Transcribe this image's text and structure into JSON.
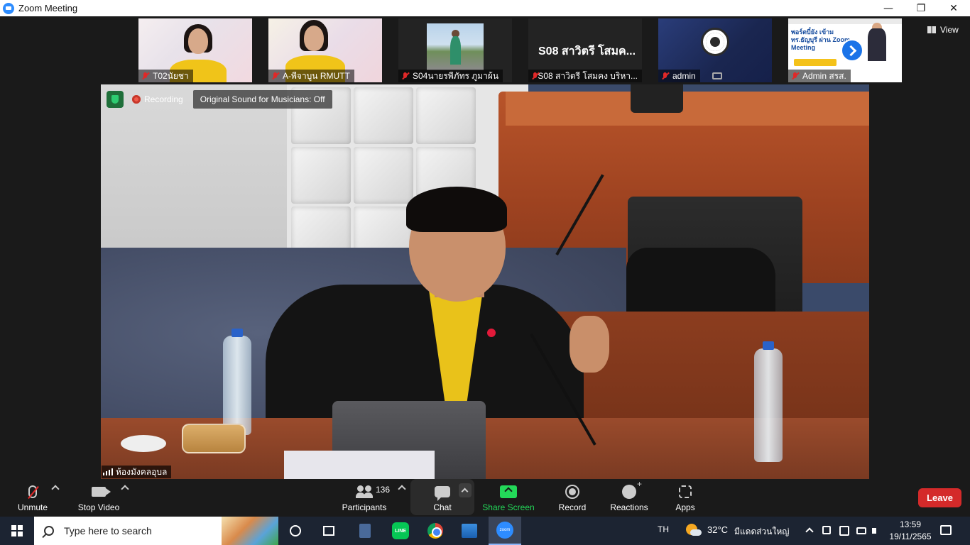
{
  "window": {
    "title": "Zoom Meeting",
    "minimize": "—",
    "restore": "❐",
    "close": "✕"
  },
  "gallery": {
    "view_label": "View",
    "participants": [
      {
        "name": "T02นัยชา",
        "muted": true
      },
      {
        "name": "A-พีจาบูน RMUTT",
        "muted": true
      },
      {
        "name": "S04นายรพีภัทร ภูมาผ้น",
        "muted": true
      },
      {
        "name": "S08 สาวิตรี โสมคง บริหา...",
        "muted": true,
        "display_text": "S08 สาวิตรี โสมค..."
      },
      {
        "name": "admin",
        "muted": true
      },
      {
        "name": "Admin สรส.",
        "muted": true
      }
    ],
    "poster_text": "พอร์ตบี๋ยัง เข้ามทร.ธัญบุรี ผ่าน Zoom Meeting",
    "poster_date": "19 พฤศจิกายน 2565"
  },
  "speaker": {
    "recording_label": "Recording",
    "original_sound_label": "Original Sound for Musicians: Off",
    "room_name": "ห้องมังคลอุบล"
  },
  "toolbar": {
    "unmute": "Unmute",
    "stop_video": "Stop Video",
    "participants": "Participants",
    "participants_count": "136",
    "chat": "Chat",
    "share_screen": "Share Screen",
    "record": "Record",
    "reactions": "Reactions",
    "apps": "Apps",
    "leave": "Leave"
  },
  "taskbar": {
    "search_placeholder": "Type here to search",
    "language": "TH",
    "temperature": "32°C",
    "weather": "มีแดดส่วนใหญ่",
    "time": "13:59",
    "date": "19/11/2565",
    "zoom_app_label": "zoom",
    "line_app_label": "LINE"
  },
  "colors": {
    "leave": "#d42a2a",
    "share": "#23d959",
    "zoom_blue": "#2d8cff",
    "muted_red": "#e02828"
  }
}
